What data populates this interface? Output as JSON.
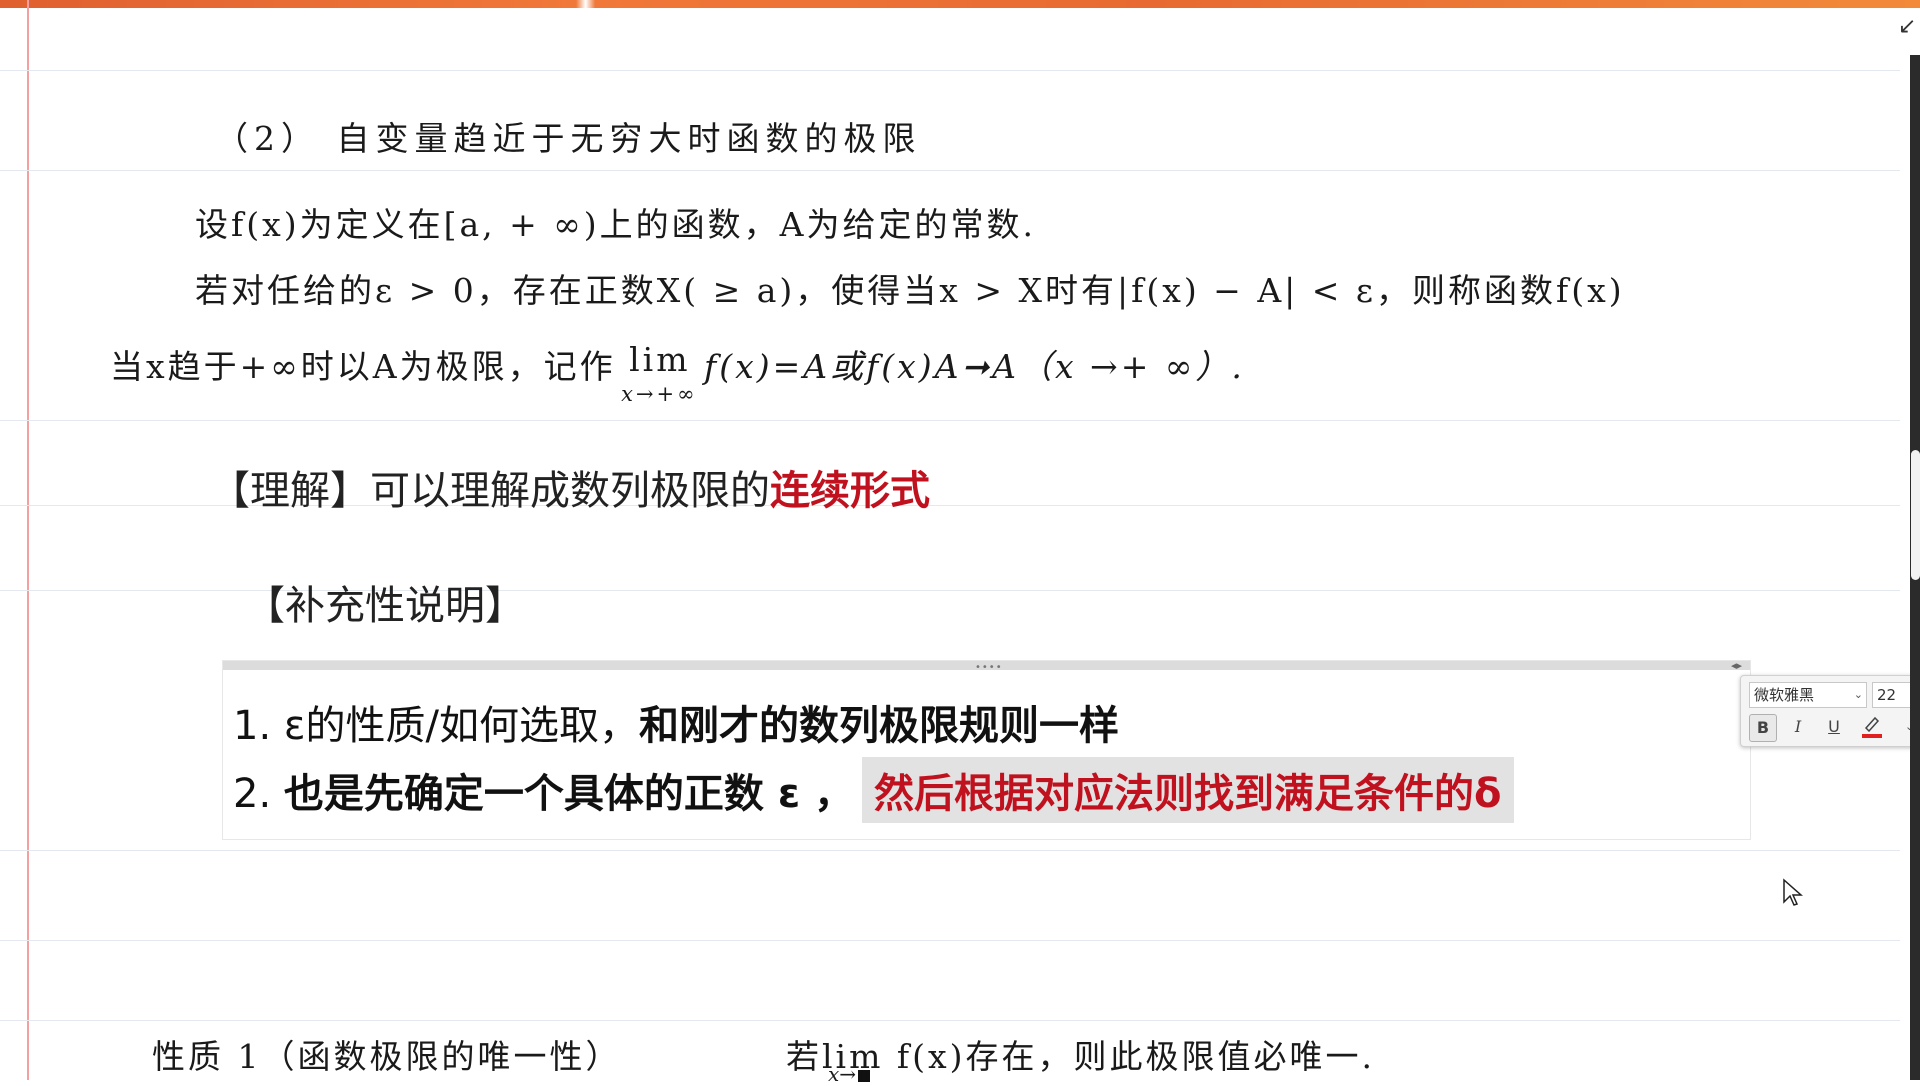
{
  "section": {
    "title": "（2） 自变量趋近于无穷大时函数的极限",
    "def_line1": "设f(x)为定义在[a, + ∞)上的函数，A为给定的常数.",
    "def_line2": "若对任给的ε > 0，存在正数X( ≥ a)，使得当x > X时有|f(x) − A| < ε，则称函数f(x)",
    "def_line3_pre": "当x趋于+∞时以A为极限，记作",
    "lim_word": "lim",
    "lim_sub": "x→+∞",
    "def_line3_post": "f(x)=A或f(x)A➞A（x →+ ∞）."
  },
  "understand": {
    "prefix": "【理解】可以理解成数列极限的",
    "highlight": "连续形式",
    "highlight_color": "#c0111f"
  },
  "supplement": {
    "title": "【补充性说明】"
  },
  "box": {
    "grip": "••••",
    "arrow": "◂▸",
    "item1_prefix": "1. ε的性质/如何选取，",
    "item1_bold": "和刚才的数列极限规则一样",
    "item2_prefix": "2. ",
    "item2_bold": "也是先确定一个具体的正数 ε ，",
    "item2_highlight": "然后根据对应法则找到满足条件的δ"
  },
  "toolbar": {
    "font_name": "微软雅黑",
    "font_size": "22",
    "bold_label": "B",
    "italic_label": "I",
    "underline_label": "U",
    "caret": "⌄"
  },
  "property": {
    "label": "性质 1（函数极限的唯一性）",
    "text": "若lim f(x)存在，则此极限值必唯一.",
    "sub": "x→"
  }
}
